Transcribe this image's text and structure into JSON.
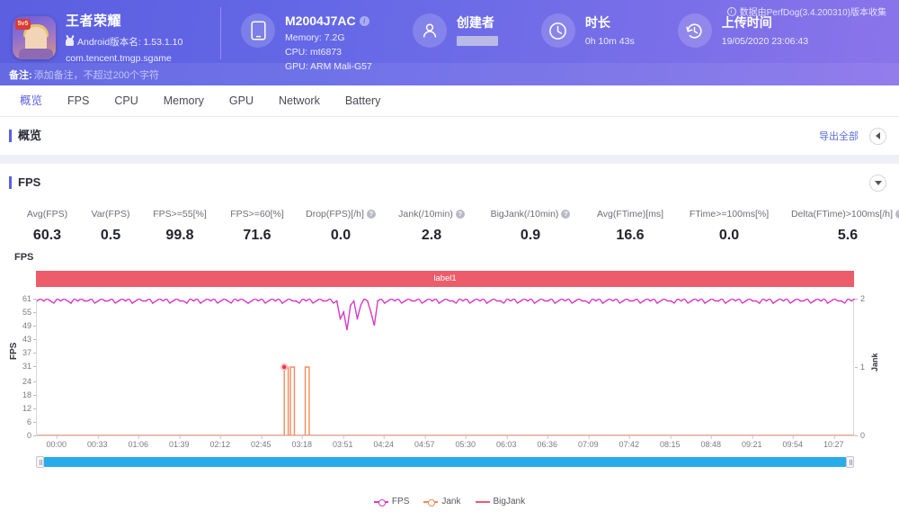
{
  "header": {
    "app": {
      "name": "王者荣耀",
      "version_line": "Android版本名: 1.53.1.10",
      "package": "com.tencent.tmgp.sgame",
      "icon": "game-avatar-icon",
      "badge": "5v5"
    },
    "device": {
      "title": "M2004J7AC",
      "memory": "Memory: 7.2G",
      "cpu": "CPU: mt6873",
      "gpu": "GPU: ARM Mali-G57",
      "icon": "phone-icon"
    },
    "creator": {
      "title": "创建者",
      "value": "",
      "icon": "user-icon"
    },
    "duration": {
      "title": "时长",
      "value": "0h 10m 43s",
      "icon": "clock-icon"
    },
    "upload": {
      "title": "上传时间",
      "value": "19/05/2020 23:06:43",
      "icon": "history-clock-icon"
    },
    "collector_note": "数据由PerfDog(3.4.200310)版本收集",
    "note": {
      "label": "备注:",
      "placeholder": "添加备注，不超过200个字符"
    }
  },
  "tabs": [
    {
      "label": "概览",
      "active": true
    },
    {
      "label": "FPS",
      "active": false
    },
    {
      "label": "CPU",
      "active": false
    },
    {
      "label": "Memory",
      "active": false
    },
    {
      "label": "GPU",
      "active": false
    },
    {
      "label": "Network",
      "active": false
    },
    {
      "label": "Battery",
      "active": false
    }
  ],
  "overview_panel": {
    "title": "概览",
    "export_label": "导出全部",
    "collapse_icon": "chevron-left-icon"
  },
  "fps_panel": {
    "title": "FPS",
    "collapse_icon": "chevron-down-icon",
    "metrics": [
      {
        "label": "Avg(FPS)",
        "value": "60.3",
        "help": false
      },
      {
        "label": "Var(FPS)",
        "value": "0.5",
        "help": false
      },
      {
        "label": "FPS>=55[%]",
        "value": "99.8",
        "help": false
      },
      {
        "label": "FPS>=60[%]",
        "value": "71.6",
        "help": false
      },
      {
        "label": "Drop(FPS)[/h]",
        "value": "0.0",
        "help": true
      },
      {
        "label": "Jank(/10min)",
        "value": "2.8",
        "help": true
      },
      {
        "label": "BigJank(/10min)",
        "value": "0.9",
        "help": true
      },
      {
        "label": "Avg(FTime)[ms]",
        "value": "16.6",
        "help": false
      },
      {
        "label": "FTime>=100ms[%]",
        "value": "0.0",
        "help": false
      },
      {
        "label": "Delta(FTime)>100ms[/h]",
        "value": "5.6",
        "help": true
      }
    ]
  },
  "chart_data": {
    "type": "line",
    "title": "FPS",
    "label_bar": "label1",
    "xlabel": "",
    "ylabel": "FPS",
    "y2label": "Jank",
    "ylim": [
      0,
      61
    ],
    "y2lim": [
      0,
      2
    ],
    "yticks": [
      0,
      6,
      12,
      18,
      24,
      31,
      37,
      43,
      49,
      55,
      61
    ],
    "y2ticks": [
      0,
      1,
      2
    ],
    "grid": false,
    "legend_position": "bottom",
    "xticks": [
      "00:00",
      "00:33",
      "01:06",
      "01:39",
      "02:12",
      "02:45",
      "03:18",
      "03:51",
      "04:24",
      "04:57",
      "05:30",
      "06:03",
      "06:36",
      "07:09",
      "07:42",
      "08:15",
      "08:48",
      "09:21",
      "09:54",
      "10:27"
    ],
    "colors": {
      "fps": "#d63bc7",
      "jank": "#f08a5d",
      "bigjank": "#ec5c6b"
    },
    "series": [
      {
        "name": "FPS",
        "axis": "left",
        "color": "#d63bc7",
        "description": "Frame rate oscillating between 58 and 61 across the whole run, with brief dips to ~52 and ~47 near 03:05-03:25",
        "values": [
          60,
          61,
          60,
          61,
          60,
          59,
          61,
          60,
          61,
          60,
          59,
          61,
          60,
          61,
          60,
          60,
          61,
          59,
          60,
          61,
          60,
          60,
          61,
          59,
          60,
          61,
          60,
          61,
          59,
          60,
          61,
          60,
          60,
          61,
          59,
          60,
          61,
          60,
          61,
          59,
          60,
          61,
          60,
          60,
          59,
          61,
          60,
          61,
          59,
          60,
          61,
          60,
          61,
          59,
          60,
          61,
          60,
          59,
          61,
          60,
          61,
          60,
          59,
          60,
          61,
          60,
          61,
          59,
          60,
          61,
          60,
          61,
          59,
          60,
          61,
          60,
          60,
          59,
          61,
          60,
          61,
          59,
          60,
          61,
          60,
          60,
          61,
          59,
          60,
          52,
          55,
          47,
          58,
          60,
          52,
          58,
          61,
          60,
          55,
          49,
          60,
          61,
          59,
          60,
          61,
          60,
          61,
          59,
          60,
          61,
          60,
          60,
          61,
          59,
          60,
          61,
          60,
          61,
          59,
          60,
          61,
          60,
          60,
          59,
          61,
          60,
          61,
          59,
          60,
          61,
          60,
          61,
          59,
          60,
          61,
          60,
          60,
          59,
          61,
          60,
          61,
          59,
          60,
          61,
          60,
          61,
          59,
          60,
          61,
          60,
          60,
          61,
          59,
          60,
          61,
          60,
          61,
          59,
          60,
          61,
          60,
          60,
          59,
          61,
          60,
          61,
          59,
          60,
          61,
          60,
          61,
          59,
          60,
          61,
          60,
          60,
          61,
          59,
          60,
          61,
          60,
          61,
          59,
          60,
          61,
          60,
          60,
          59,
          61,
          60,
          61,
          59,
          60,
          61,
          60,
          61,
          59,
          60,
          61,
          60,
          60,
          61,
          59,
          60,
          61,
          60,
          61,
          59,
          60,
          61,
          60,
          60,
          59,
          61,
          60,
          61,
          59,
          60,
          61,
          60,
          61,
          59,
          60,
          61,
          60,
          60,
          61,
          59,
          60,
          61,
          60,
          61,
          59,
          60,
          61,
          60,
          60,
          59,
          61,
          60,
          61
        ]
      },
      {
        "name": "Jank",
        "axis": "right",
        "color": "#f08a5d",
        "description": "Flat at 0 with three single-sample spikes to 1 near 03:05, 03:10 and 03:22",
        "spikes": [
          {
            "x": "03:05",
            "value": 1
          },
          {
            "x": "03:10",
            "value": 1
          },
          {
            "x": "03:22",
            "value": 1
          }
        ]
      },
      {
        "name": "BigJank",
        "axis": "right",
        "color": "#ec5c6b",
        "description": "Single big-jank marker at 03:05 with value 1",
        "spikes": [
          {
            "x": "03:05",
            "value": 1
          }
        ]
      }
    ]
  },
  "legend": [
    {
      "label": "FPS",
      "color": "#d63bc7",
      "marker": "line-dot"
    },
    {
      "label": "Jank",
      "color": "#f08a5d",
      "marker": "line-dot"
    },
    {
      "label": "BigJank",
      "color": "#ec5c6b",
      "marker": "line"
    }
  ],
  "scrollbar": {
    "name": "chart-range-slider",
    "left_handle": "range-handle-left",
    "right_handle": "range-handle-right"
  }
}
